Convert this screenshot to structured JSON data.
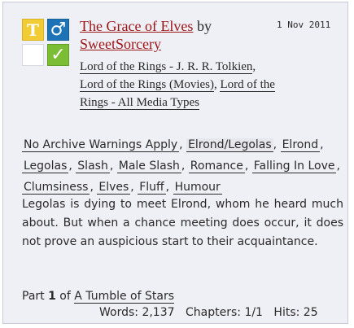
{
  "work": {
    "title": "The Grace of Elves",
    "by": "by",
    "author": "SweetSorcery",
    "date": "1 Nov 2011"
  },
  "icons": {
    "rating": {
      "name": "rating-teen-icon",
      "glyph": "T",
      "color": "#f2cc34"
    },
    "category": {
      "name": "male-male-category-icon",
      "glyph": "♂",
      "color": "#1d73b6"
    },
    "warnings": {
      "name": "no-warnings-icon",
      "color": "#ffffff"
    },
    "complete": {
      "name": "complete-check-icon",
      "glyph": "✓",
      "color": "#7bbd34"
    }
  },
  "fandoms": [
    "Lord of the Rings - J. R. R. Tolkien",
    "Lord of the Rings (Movies)",
    "Lord of the Rings - All Media Types"
  ],
  "tags": [
    "No Archive Warnings Apply",
    "Elrond/Legolas",
    "Elrond",
    "Legolas",
    "Slash",
    "Male Slash",
    "Romance",
    "Falling In Love",
    "Clumsiness",
    "Elves",
    "Fluff",
    "Humour"
  ],
  "summary": "Legolas is dying to meet Elrond, whom he heard much about. But when a chance meeting does occur, it does not prove an auspicious start to their acquaintance.",
  "series": {
    "part_label": "Part",
    "part_number": "1",
    "of_label": "of",
    "series_title": "A Tumble of Stars"
  },
  "stats": {
    "words_label": "Words:",
    "words": "2,137",
    "chapters_label": "Chapters:",
    "chapters": "1/1",
    "hits_label": "Hits:",
    "hits": "25"
  },
  "colors": {
    "link": "#9c1515",
    "blurb_background": "#efeff6"
  }
}
